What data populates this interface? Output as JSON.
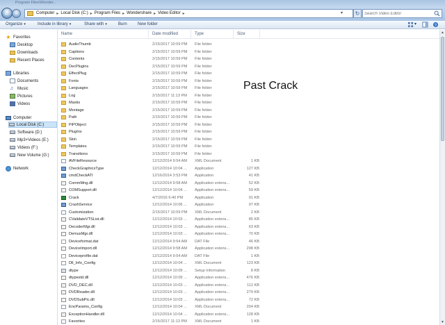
{
  "window": {
    "title_fragment": "Program Files\\Wonder..."
  },
  "address": {
    "crumbs": [
      "Computer",
      "Local Disk (C:)",
      "Program Files",
      "Wondershare",
      "Video Editor"
    ]
  },
  "search": {
    "placeholder": "Search Video Editor"
  },
  "toolbar": {
    "organize": "Organize",
    "include_in_library": "Include in library",
    "share_with": "Share with",
    "burn": "Burn",
    "new_folder": "New folder"
  },
  "nav": {
    "favorites": "Favorites",
    "desktop": "Desktop",
    "downloads": "Downloads",
    "recent_places": "Recent Places",
    "libraries": "Libraries",
    "documents": "Documents",
    "music": "Music",
    "pictures": "Pictures",
    "videos": "Videos",
    "computer": "Computer",
    "local_disk": "Local Disk (C:)",
    "software": "Software (D:)",
    "mp3_videos": "Mp3+Videos (E:)",
    "videos_f": "Videos (F:)",
    "new_volume": "New Volume (G:)",
    "network": "Network"
  },
  "columns": {
    "name": "Name",
    "date": "Date modified",
    "type": "Type",
    "size": "Size"
  },
  "files": [
    {
      "icon": "folder",
      "name": "AudioThumb",
      "date": "2/15/2017 10:59 PM",
      "type": "File folder",
      "size": ""
    },
    {
      "icon": "folder",
      "name": "Captions",
      "date": "2/15/2017 10:59 PM",
      "type": "File folder",
      "size": ""
    },
    {
      "icon": "folder",
      "name": "Contents",
      "date": "2/15/2017 10:59 PM",
      "type": "File folder",
      "size": ""
    },
    {
      "icon": "folder",
      "name": "DecPlugins",
      "date": "2/15/2017 10:59 PM",
      "type": "File folder",
      "size": ""
    },
    {
      "icon": "folder",
      "name": "EffectPlug",
      "date": "2/15/2017 10:59 PM",
      "type": "File folder",
      "size": ""
    },
    {
      "icon": "folder",
      "name": "Fonts",
      "date": "2/15/2017 10:59 PM",
      "type": "File folder",
      "size": ""
    },
    {
      "icon": "folder",
      "name": "Languages",
      "date": "2/15/2017 10:59 PM",
      "type": "File folder",
      "size": ""
    },
    {
      "icon": "folder",
      "name": "Log",
      "date": "2/15/2017 11:13 PM",
      "type": "File folder",
      "size": ""
    },
    {
      "icon": "folder",
      "name": "Masks",
      "date": "2/15/2017 10:59 PM",
      "type": "File folder",
      "size": ""
    },
    {
      "icon": "folder",
      "name": "Montage",
      "date": "2/15/2017 10:59 PM",
      "type": "File folder",
      "size": ""
    },
    {
      "icon": "folder",
      "name": "Path",
      "date": "2/15/2017 10:59 PM",
      "type": "File folder",
      "size": ""
    },
    {
      "icon": "folder",
      "name": "PiPObject",
      "date": "2/15/2017 10:59 PM",
      "type": "File folder",
      "size": ""
    },
    {
      "icon": "folder",
      "name": "PlugIns",
      "date": "2/15/2017 10:59 PM",
      "type": "File folder",
      "size": ""
    },
    {
      "icon": "folder",
      "name": "Skin",
      "date": "2/15/2017 10:59 PM",
      "type": "File folder",
      "size": ""
    },
    {
      "icon": "folder",
      "name": "Templates",
      "date": "2/15/2017 10:59 PM",
      "type": "File folder",
      "size": ""
    },
    {
      "icon": "folder",
      "name": "Transitions",
      "date": "2/15/2017 10:59 PM",
      "type": "File folder",
      "size": ""
    },
    {
      "icon": "xml",
      "name": "AVFileResource",
      "date": "12/12/2014 9:54 AM",
      "type": "XML Document",
      "size": "1 KB"
    },
    {
      "icon": "app",
      "name": "CheckGraphicsType",
      "date": "12/12/2014 10:04 ...",
      "type": "Application",
      "size": "127 KB"
    },
    {
      "icon": "app",
      "name": "cmdCheckATI",
      "date": "12/16/2014 3:53 PM",
      "type": "Application",
      "size": "41 KB"
    },
    {
      "icon": "dll",
      "name": "CommMng.dll",
      "date": "12/12/2014 9:58 AM",
      "type": "Application extens...",
      "size": "52 KB"
    },
    {
      "icon": "dll",
      "name": "COMSupport.dll",
      "date": "12/12/2014 10:04 ...",
      "type": "Application extens...",
      "size": "59 KB"
    },
    {
      "icon": "crack",
      "name": "Crack",
      "date": "4/7/2016 6:40 PM",
      "type": "Application",
      "size": "91 KB"
    },
    {
      "icon": "app",
      "name": "CrashService",
      "date": "12/12/2014 10:06 ...",
      "type": "Application",
      "size": "97 KB"
    },
    {
      "icon": "xml",
      "name": "Customization",
      "date": "2/15/2017 10:59 PM",
      "type": "XML Document",
      "size": "2 KB"
    },
    {
      "icon": "dll",
      "name": "CValidateVTSList.dll",
      "date": "12/12/2014 10:03 ...",
      "type": "Application extens...",
      "size": "85 KB"
    },
    {
      "icon": "dll",
      "name": "DecoderMgr.dll",
      "date": "12/12/2014 10:03 ...",
      "type": "Application extens...",
      "size": "63 KB"
    },
    {
      "icon": "dll",
      "name": "DemuxMgr.dll",
      "date": "12/12/2014 10:03 ...",
      "type": "Application extens...",
      "size": "70 KB"
    },
    {
      "icon": "dat",
      "name": "Deviceformat.dat",
      "date": "12/12/2014 9:54 AM",
      "type": "DAT File",
      "size": "46 KB"
    },
    {
      "icon": "dll",
      "name": "DeviceImport.dll",
      "date": "12/12/2014 9:58 AM",
      "type": "Application extens...",
      "size": "298 KB"
    },
    {
      "icon": "dat",
      "name": "Deviceprofile.dat",
      "date": "12/12/2014 9:54 AM",
      "type": "DAT File",
      "size": "1 KB"
    },
    {
      "icon": "xml",
      "name": "Dll_Info_Config",
      "date": "12/12/2014 10:04 ...",
      "type": "XML Document",
      "size": "123 KB"
    },
    {
      "icon": "setup",
      "name": "dtype",
      "date": "12/12/2014 10:09 ...",
      "type": "Setup Information",
      "size": "8 KB"
    },
    {
      "icon": "dll",
      "name": "dtypestd.dll",
      "date": "12/12/2014 10:09 ...",
      "type": "Application extens...",
      "size": "476 KB"
    },
    {
      "icon": "dll",
      "name": "DVD_DEC.dll",
      "date": "12/12/2014 10:03 ...",
      "type": "Application extens...",
      "size": "112 KB"
    },
    {
      "icon": "dll",
      "name": "DVDReader.dll",
      "date": "12/12/2014 10:03 ...",
      "type": "Application extens...",
      "size": "279 KB"
    },
    {
      "icon": "dll",
      "name": "DVDSubPic.dll",
      "date": "12/12/2014 10:03 ...",
      "type": "Application extens...",
      "size": "72 KB"
    },
    {
      "icon": "xml",
      "name": "EncParams_Config",
      "date": "12/12/2014 10:04 ...",
      "type": "XML Document",
      "size": "204 KB"
    },
    {
      "icon": "dll",
      "name": "ExceptionHandler.dll",
      "date": "12/12/2014 10:04 ...",
      "type": "Application extens...",
      "size": "128 KB"
    },
    {
      "icon": "xml",
      "name": "Favorites",
      "date": "2/15/2017 11:13 PM",
      "type": "XML Document",
      "size": "1 KB"
    }
  ],
  "overlay_text": "Past Crack"
}
